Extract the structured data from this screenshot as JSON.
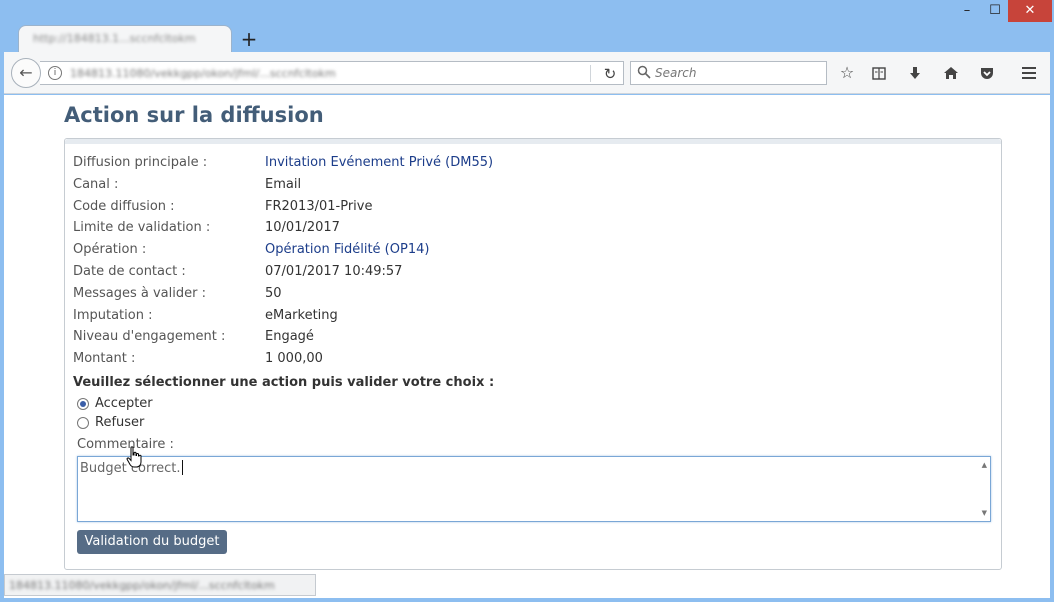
{
  "browser": {
    "tab_title": "http://184813.1...sccnfcltokm",
    "new_tab_symbol": "+",
    "url": "184813.11080/vekkgpp/okon/jfml/...sccnfcltokm",
    "search_placeholder": "Search",
    "status_url": "184813.11080/vekkgpp/okon/jfml/...sccnfcltokm",
    "window_controls": {
      "minimize": "–",
      "maximize": "☐",
      "close": "✕"
    },
    "icons": [
      "back-icon",
      "info-icon",
      "reload-icon",
      "search-icon",
      "bookmark-star-icon",
      "reading-list-icon",
      "download-icon",
      "home-icon",
      "pocket-icon",
      "menu-icon"
    ]
  },
  "page": {
    "title": "Action sur la diffusion",
    "details": [
      {
        "label": "Diffusion principale :",
        "value": "Invitation Evénement Privé (DM55)",
        "link": true
      },
      {
        "label": "Canal :",
        "value": "Email",
        "link": false
      },
      {
        "label": "Code diffusion :",
        "value": "FR2013/01-Prive",
        "link": false
      },
      {
        "label": "Limite de validation :",
        "value": "10/01/2017",
        "link": false
      },
      {
        "label": "Opération :",
        "value": "Opération Fidélité (OP14)",
        "link": true
      },
      {
        "label": "Date de contact :",
        "value": "07/01/2017 10:49:57",
        "link": false
      },
      {
        "label": "Messages à valider :",
        "value": "50",
        "link": false
      },
      {
        "label": "Imputation :",
        "value": "eMarketing",
        "link": false
      },
      {
        "label": "Niveau d'engagement :",
        "value": "Engagé",
        "link": false
      },
      {
        "label": "Montant :",
        "value": "1 000,00",
        "link": false
      }
    ],
    "prompt": "Veuillez sélectionner une action puis valider votre choix :",
    "options": [
      {
        "label": "Accepter",
        "checked": true
      },
      {
        "label": "Refuser",
        "checked": false
      }
    ],
    "comment_label": "Commentaire :",
    "comment_value": "Budget correct.",
    "submit_label": "Validation du budget"
  },
  "colors": {
    "title": "#435d78",
    "link": "#1c3d8a",
    "button": "#566c86",
    "window_frame": "#8dbef0",
    "close_button": "#c7443a"
  }
}
